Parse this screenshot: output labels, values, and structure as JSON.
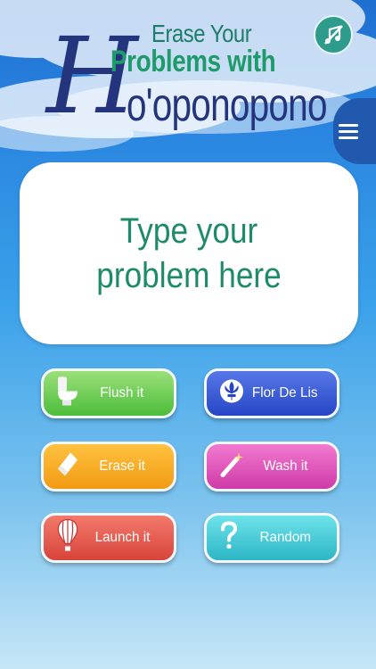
{
  "header": {
    "line1": "Erase Your",
    "line2": "Problems with",
    "logo_h": "H",
    "logo_rest": "o'oponopono"
  },
  "controls": {
    "music_icon": "music-off-icon",
    "menu_icon": "hamburger-menu-icon"
  },
  "input": {
    "placeholder": "Type your problem here"
  },
  "buttons": [
    {
      "label": "Flush it",
      "icon": "toilet-icon",
      "color": "#4cbd3a"
    },
    {
      "label": "Flor De Lis",
      "icon": "fleur-de-lis-icon",
      "color": "#2645c6"
    },
    {
      "label": "Erase it",
      "icon": "eraser-icon",
      "color": "#f19a12"
    },
    {
      "label": "Wash it",
      "icon": "magic-wand-icon",
      "color": "#cf3aa8"
    },
    {
      "label": "Launch it",
      "icon": "hot-air-balloon-icon",
      "color": "#d8443a"
    },
    {
      "label": "Random",
      "icon": "question-mark-icon",
      "color": "#2db6c6"
    }
  ]
}
